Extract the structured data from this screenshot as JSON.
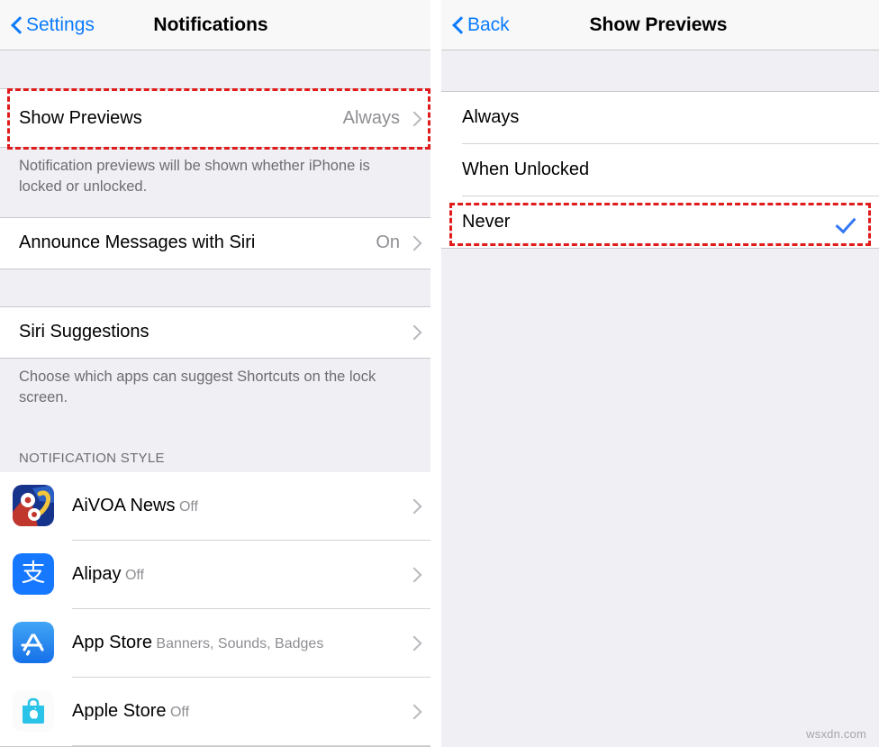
{
  "left_screen": {
    "nav": {
      "back_label": "Settings",
      "title": "Notifications",
      "back_icon": "chevron-left-icon"
    },
    "show_previews_row": {
      "label": "Show Previews",
      "value": "Always",
      "chevron_icon": "chevron-right-icon"
    },
    "show_previews_footnote": "Notification previews will be shown whether iPhone is locked or unlocked.",
    "announce_row": {
      "label": "Announce Messages with Siri",
      "value": "On",
      "chevron_icon": "chevron-right-icon"
    },
    "siri_suggestions_row": {
      "label": "Siri Suggestions",
      "value": "",
      "chevron_icon": "chevron-right-icon"
    },
    "siri_suggestions_footnote": "Choose which apps can suggest Shortcuts on the lock screen.",
    "notification_style_header": "NOTIFICATION STYLE",
    "apps": [
      {
        "name": "AiVOA News",
        "status": "Off",
        "icon": "aivoa-news-app-icon",
        "chevron_icon": "chevron-right-icon"
      },
      {
        "name": "Alipay",
        "status": "Off",
        "icon": "alipay-app-icon",
        "chevron_icon": "chevron-right-icon"
      },
      {
        "name": "App Store",
        "status": "Banners, Sounds, Badges",
        "icon": "app-store-app-icon",
        "chevron_icon": "chevron-right-icon"
      },
      {
        "name": "Apple Store",
        "status": "Off",
        "icon": "apple-store-app-icon",
        "chevron_icon": "chevron-right-icon"
      }
    ],
    "highlight": {
      "target": "Show Previews",
      "color": "#e01b1b",
      "style": "dashed"
    }
  },
  "right_screen": {
    "nav": {
      "back_label": "Back",
      "title": "Show Previews",
      "back_icon": "chevron-left-icon"
    },
    "options": [
      {
        "label": "Always",
        "selected": false
      },
      {
        "label": "When Unlocked",
        "selected": false
      },
      {
        "label": "Never",
        "selected": true,
        "check_icon": "checkmark-icon"
      }
    ],
    "highlight": {
      "target": "Never",
      "color": "#e01b1b",
      "style": "dashed"
    }
  },
  "watermark": "wsxdn.com",
  "colors": {
    "accent_blue": "#0b7bfd",
    "check_blue": "#3478f6",
    "highlight_red": "#e01b1b",
    "group_background": "#efeff4",
    "row_background": "#ffffff",
    "secondary_text": "#8e8e93"
  }
}
